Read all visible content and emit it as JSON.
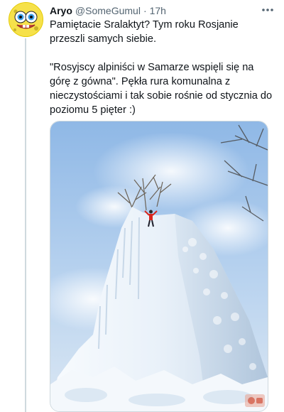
{
  "tweet": {
    "author": {
      "display_name": "Aryo",
      "handle": "@SomeGumul",
      "separator": "·",
      "time": "17h",
      "avatar": "spongebob-avatar"
    },
    "text": {
      "paragraph1": "Pamiętacie Sralaktyt? Tym roku Rosjanie przeszli samych siebie.",
      "paragraph2": "\"Rosyjscy alpiniści w Samarze wspięli się na górę z gówna\". Pękła rura komunalna z nieczystościami i tak sobie rośnie od stycznia do poziomu 5 pięter :)"
    },
    "more_icon": "more-horizontal-icon",
    "media": {
      "type": "photo",
      "subject": "ice-mountain-with-climber"
    }
  },
  "colors": {
    "text": "#0f1419",
    "secondary": "#536471",
    "thread_line": "#cfd9de",
    "sky": "#9ec3ea",
    "ice": "#eef4fa"
  }
}
